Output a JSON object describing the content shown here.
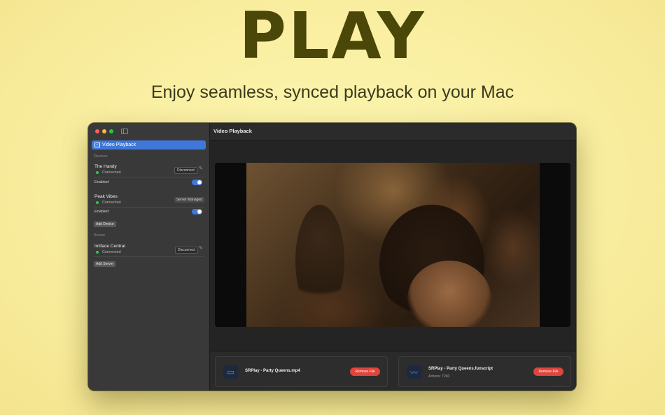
{
  "hero": {
    "title": "PLAY",
    "subtitle": "Enjoy seamless, synced playback on your Mac"
  },
  "colors": {
    "accent": "#3f78d8",
    "remove": "#e0443a",
    "connected": "#2dc84a",
    "hero_text": "#4a4708"
  },
  "sidebar": {
    "nav_item": "Video Playback",
    "devices_header": "Devices",
    "devices": [
      {
        "name": "The Handy",
        "status": "Connected",
        "action": "Disconnect",
        "enabled_label": "Enabled",
        "enabled": true
      },
      {
        "name": "Peak Vibes",
        "status": "Connected",
        "action": "Server Managed",
        "enabled_label": "Enabled",
        "enabled": true
      }
    ],
    "add_device": "Add Device",
    "server_header": "Server",
    "server": {
      "name": "Intiface Central",
      "status": "Connected",
      "action": "Disconnect"
    },
    "add_server": "Add Server"
  },
  "main": {
    "title": "Video Playback",
    "files": [
      {
        "icon": "video-camera-icon",
        "name": "SRPlay - Party Queens.mp4",
        "meta": "",
        "action": "Remove File"
      },
      {
        "icon": "waveform-icon",
        "name": "SRPlay - Party Queens.funscript",
        "meta": "Actions: 7260",
        "action": "Remove File"
      }
    ]
  }
}
